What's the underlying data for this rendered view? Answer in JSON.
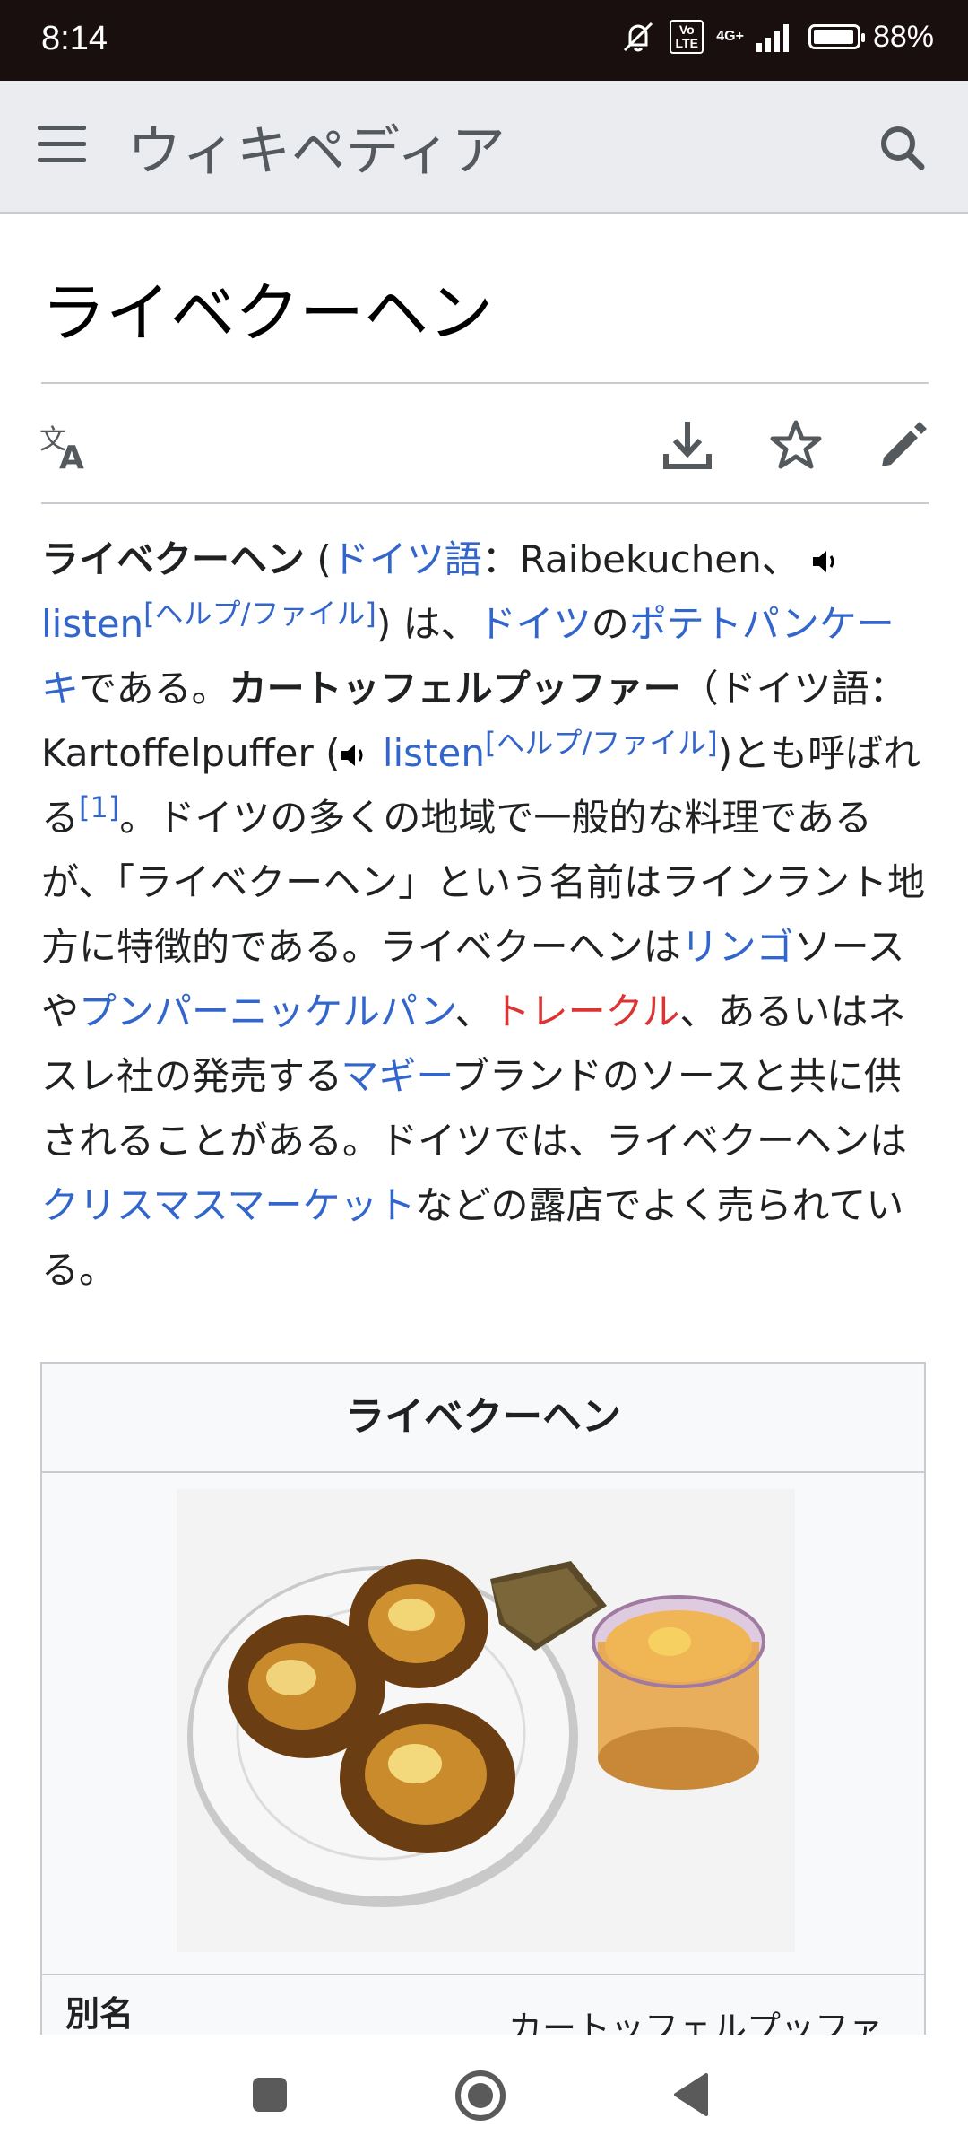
{
  "status": {
    "time": "8:14",
    "network_volte": "Vo LTE",
    "network_type": "4G+",
    "battery": "88%"
  },
  "header": {
    "wordmark": "ウィキペディア"
  },
  "article": {
    "title": "ライベクーヘン"
  },
  "body": {
    "p1_bold": "ライベクーヘン",
    "p1_a": " (",
    "link_german": "ドイツ語",
    "p1_b": "：Raibekuchen、",
    "listen1": "listen",
    "help1": "[ヘルプ/ファイル]",
    "p1_c": ") は、",
    "link_germany": "ドイツ",
    "p1_d": "の",
    "link_pancake": "ポテトパンケーキ",
    "p1_e": "である。",
    "p1_bold2": "カートッフェルプッファー",
    "p1_f": "（ドイツ語：Kartoffelpuffer (",
    "listen2": "listen",
    "help2": "[ヘルプ/ファイル]",
    "p1_g": ")とも呼ばれる",
    "ref1": "[1]",
    "p1_h": "。ドイツの多くの地域で一般的な料理であるが、「ライベクーヘン」という名前はラインラント地方に特徴的である。ライベクーヘンは",
    "link_apple": "リンゴ",
    "p1_i": "ソースや",
    "link_pumpernickel": "プンパーニッケルパン",
    "p1_j": "、",
    "link_treacle": "トレークル",
    "p1_k": "、あるいはネスレ社の発売する",
    "link_maggi": "マギー",
    "p1_l": "ブランドのソースと共に供されることがある。ドイツでは、ライベクーヘンは",
    "link_xmas": "クリスマスマーケット",
    "p1_m": "などの露店でよく売られている。"
  },
  "infobox": {
    "title": "ライベクーヘン",
    "alias_label": "別名",
    "alias_value": "カートッフェルプッファ"
  },
  "colors": {
    "link": "#3366cc",
    "redlink": "#dd3333",
    "header_bg": "#eaecf0"
  }
}
